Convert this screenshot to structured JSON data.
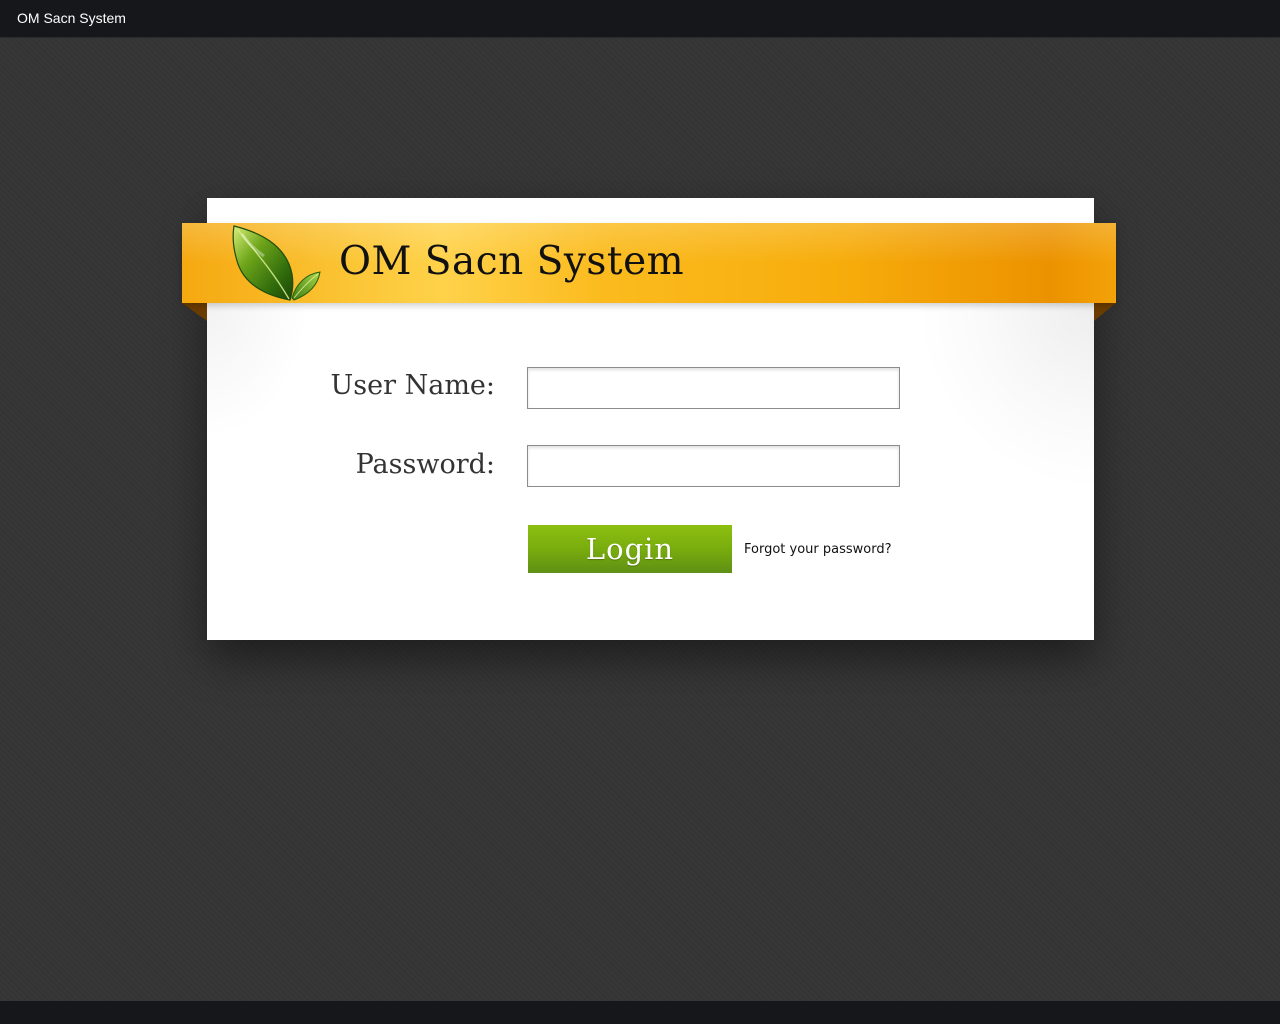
{
  "window": {
    "title": "OM Sacn System"
  },
  "header": {
    "title": "OM Sacn System",
    "logo_icon": "leaf-icon"
  },
  "form": {
    "username_label": "User Name:",
    "username_value": "",
    "password_label": "Password:",
    "password_value": "",
    "login_label": "Login",
    "forgot_label": "Forgot your password?"
  },
  "colors": {
    "background": "#353535",
    "topbar": "#16171a",
    "ribbon": "#f7ad0c",
    "login_button": "#79ad0e",
    "card": "#ffffff"
  }
}
